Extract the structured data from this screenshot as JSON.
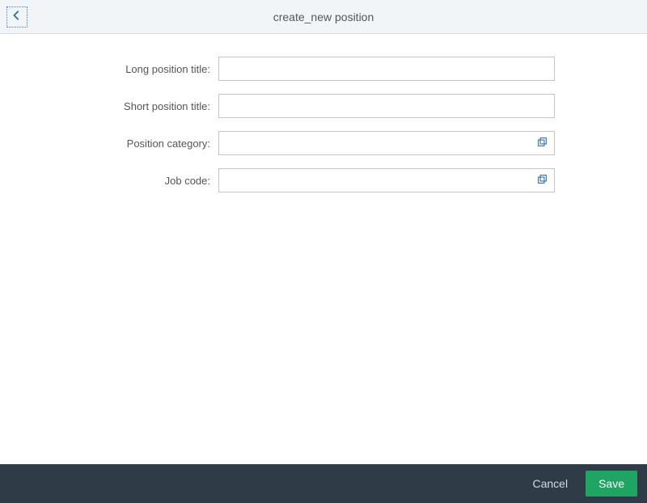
{
  "header": {
    "title": "create_new position"
  },
  "form": {
    "fields": [
      {
        "label": "Long position title:",
        "value": "",
        "type": "text"
      },
      {
        "label": "Short position title:",
        "value": "",
        "type": "text"
      },
      {
        "label": "Position category:",
        "value": "",
        "type": "valuehelp"
      },
      {
        "label": "Job code:",
        "value": "",
        "type": "valuehelp"
      }
    ]
  },
  "footer": {
    "cancel_label": "Cancel",
    "save_label": "Save"
  }
}
